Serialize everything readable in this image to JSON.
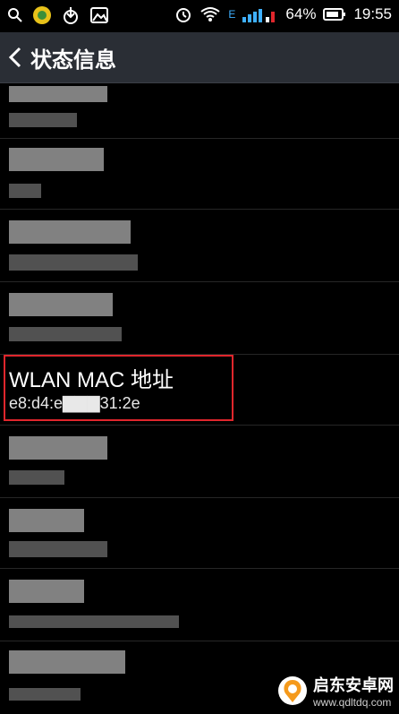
{
  "status_bar": {
    "battery_percent": "64%",
    "time": "19:55",
    "network_type": "E",
    "icons": [
      "search-icon",
      "app-icon",
      "download-icon",
      "image-icon",
      "alarm-icon",
      "wifi-icon",
      "signal-icon",
      "battery-icon"
    ]
  },
  "app_bar": {
    "title": "状态信息",
    "back_icon": "chevron-left-icon"
  },
  "list": {
    "highlighted_item": {
      "label": "WLAN MAC 地址",
      "value": "e8:d4:e▇▇▇31:2e"
    }
  },
  "watermark": {
    "line1": "启东安卓网",
    "line2": "www.qdltdq.com"
  },
  "colors": {
    "app_bar_bg": "#2a2e35",
    "highlight_border": "#e0262c",
    "background": "#000000"
  }
}
